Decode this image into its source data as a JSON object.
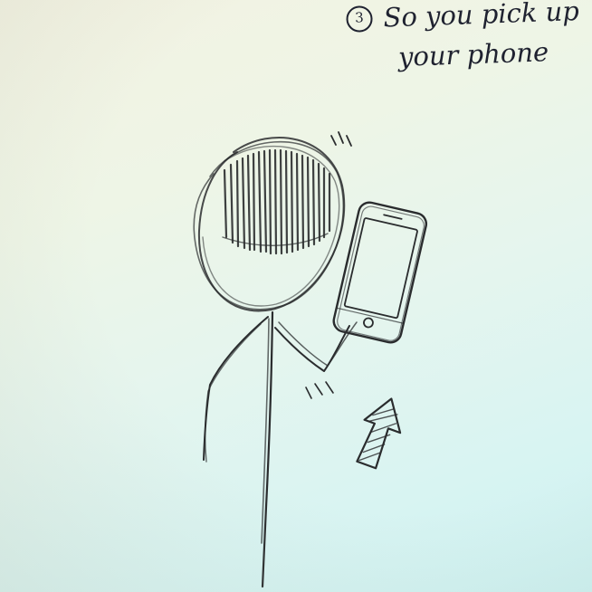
{
  "caption": {
    "step_number": "3",
    "line1": "So you pick up",
    "line2": "your phone"
  }
}
